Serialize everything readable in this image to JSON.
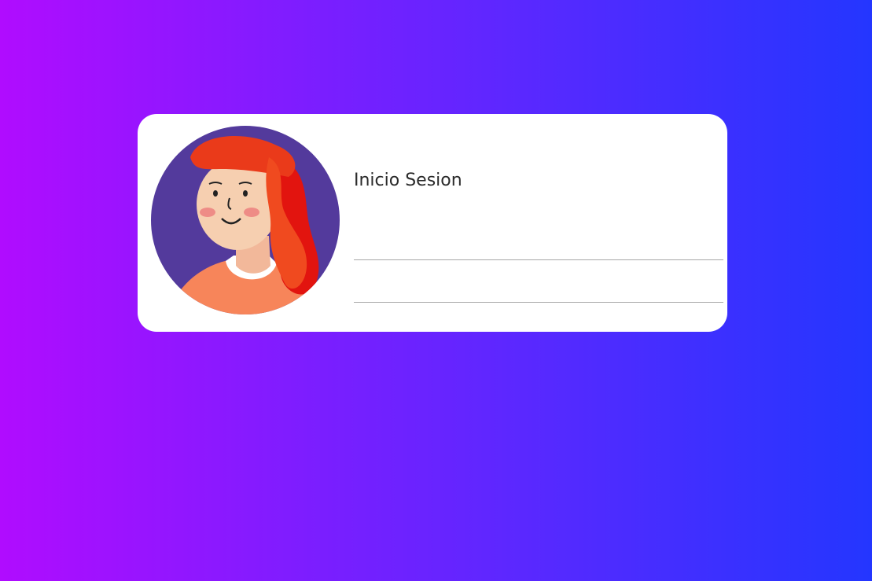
{
  "login": {
    "title": "Inicio Sesion",
    "username": {
      "value": "",
      "placeholder": ""
    },
    "password": {
      "value": "",
      "placeholder": ""
    }
  },
  "avatar": {
    "icon": "avatar-woman-red-hair-icon"
  },
  "colors": {
    "gradient_start": "#b00cff",
    "gradient_end": "#2436ff",
    "card_background": "#ffffff",
    "avatar_background": "#533a9c",
    "hair": "#e8311a",
    "shirt": "#f7855a"
  }
}
